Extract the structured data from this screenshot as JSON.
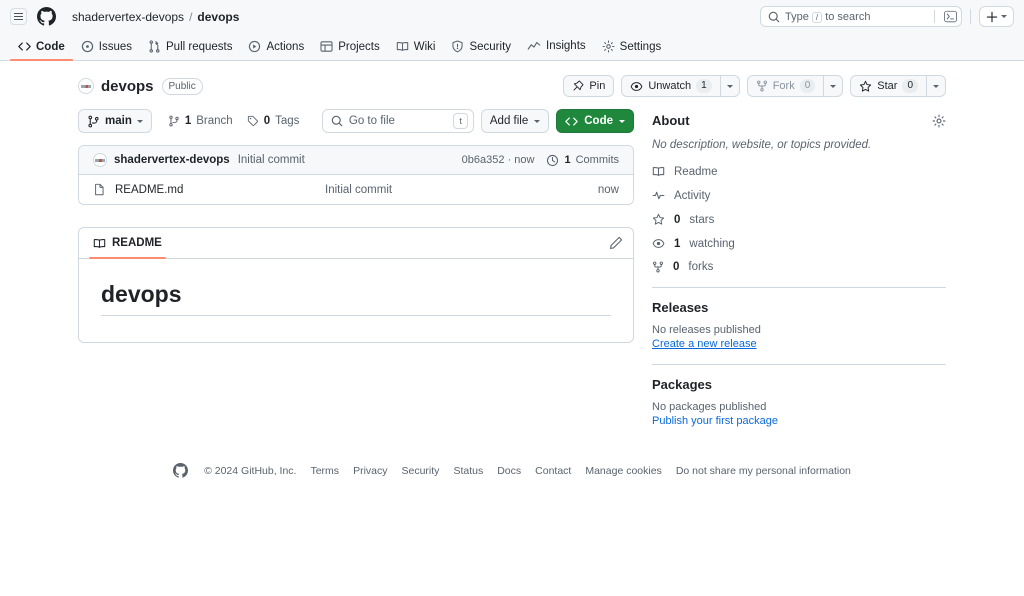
{
  "header": {
    "menu_label": "menu",
    "breadcrumb": {
      "owner": "shadervertex-devops",
      "separator": "/",
      "repo": "devops"
    },
    "search": {
      "placeholder": "Type  to search",
      "slash_key": "/"
    },
    "create_label": "+"
  },
  "repo_nav": [
    {
      "label": "Code",
      "icon": "code-icon",
      "active": true
    },
    {
      "label": "Issues",
      "icon": "issue-opened-icon",
      "active": false
    },
    {
      "label": "Pull requests",
      "icon": "git-pull-request-icon",
      "active": false
    },
    {
      "label": "Actions",
      "icon": "play-icon",
      "active": false
    },
    {
      "label": "Projects",
      "icon": "table-icon",
      "active": false
    },
    {
      "label": "Wiki",
      "icon": "book-icon",
      "active": false
    },
    {
      "label": "Security",
      "icon": "shield-icon",
      "active": false
    },
    {
      "label": "Insights",
      "icon": "graph-icon",
      "active": false
    },
    {
      "label": "Settings",
      "icon": "gear-icon",
      "active": false
    }
  ],
  "repo": {
    "name": "devops",
    "visibility": "Public",
    "actions": {
      "pin": "Pin",
      "watch": "Unwatch",
      "watch_count": "1",
      "fork": "Fork",
      "fork_count": "0",
      "star": "Star",
      "star_count": "0"
    }
  },
  "file_toolbar": {
    "branch": "main",
    "branch_count": "1",
    "branch_label": "Branch",
    "tag_count": "0",
    "tag_label": "Tags",
    "go_to_file_placeholder": "Go to file",
    "go_to_file_key": "t",
    "add_file": "Add file",
    "code": "Code"
  },
  "commit_bar": {
    "author": "shadervertex-devops",
    "message": "Initial commit",
    "hash": "0b6a352",
    "separator": "·",
    "time": "now",
    "commits_count": "1",
    "commits_label": "Commits"
  },
  "files": [
    {
      "name": "README.md",
      "icon": "file-icon",
      "message": "Initial commit",
      "time": "now"
    }
  ],
  "readme": {
    "tab_label": "README",
    "edit_label": "edit",
    "heading": "devops"
  },
  "about": {
    "title": "About",
    "description": "No description, website, or topics provided.",
    "links": [
      {
        "icon": "book-icon",
        "label": "Readme",
        "count": ""
      },
      {
        "icon": "pulse-icon",
        "label": "Activity",
        "count": ""
      },
      {
        "icon": "star-icon",
        "label": "stars",
        "count": "0"
      },
      {
        "icon": "eye-icon",
        "label": "watching",
        "count": "1"
      },
      {
        "icon": "fork-icon",
        "label": "forks",
        "count": "0"
      }
    ]
  },
  "releases": {
    "title": "Releases",
    "empty": "No releases published",
    "action": "Create a new release"
  },
  "packages": {
    "title": "Packages",
    "empty": "No packages published",
    "action": "Publish your first package"
  },
  "footer": {
    "copyright": "© 2024 GitHub, Inc.",
    "links": [
      "Terms",
      "Privacy",
      "Security",
      "Status",
      "Docs",
      "Contact",
      "Manage cookies",
      "Do not share my personal information"
    ]
  },
  "colors": {
    "accent_green": "#1f883d",
    "link_blue": "#0969da",
    "underline_orange": "#fd8c73",
    "header_bg": "#f6f8fa",
    "border": "#d1d9e0"
  }
}
